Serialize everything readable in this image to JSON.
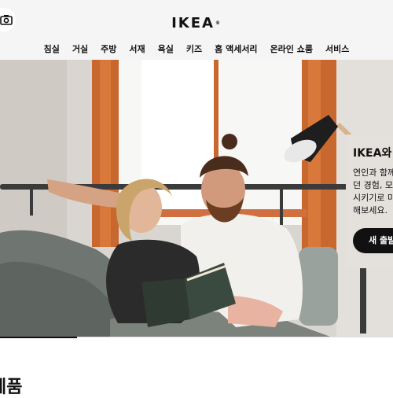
{
  "header": {
    "camera_icon": "camera-icon",
    "logo_text": "IKEA",
    "logo_mark": "®",
    "nav": [
      "침실",
      "거실",
      "주방",
      "서재",
      "욕실",
      "키즈",
      "홈 액세서리",
      "온라인 쇼룸",
      "서비스"
    ]
  },
  "hero": {
    "title": "IKEA와",
    "lines": [
      "연인과 함께",
      "던 경험, 모",
      "시키기로 마",
      "해보세요."
    ],
    "cta_label": "새 출발"
  },
  "section": {
    "title": "제품"
  },
  "colors": {
    "header_bg": "#f5f5f5",
    "cta_bg": "#111111",
    "window_frame": "#c8672e"
  }
}
